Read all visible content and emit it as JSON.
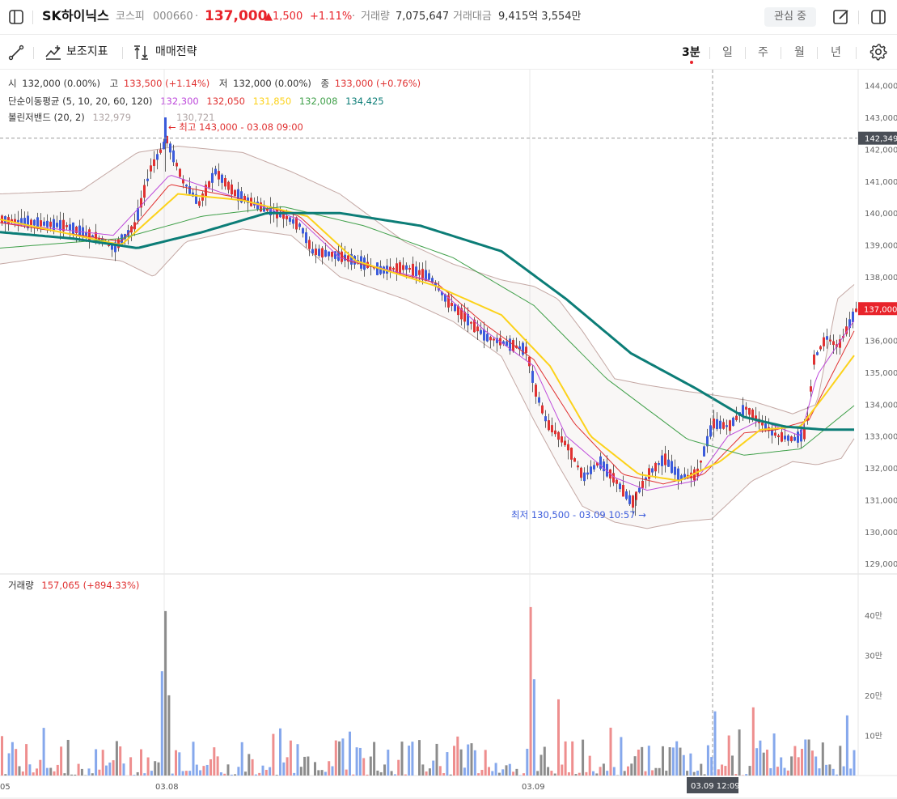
{
  "header": {
    "name": "SK하이닉스",
    "market": "코스피",
    "code": "000660",
    "dot": "·",
    "price": "137,000",
    "change": "▲1,500",
    "change_pct": "+1.11%",
    "volume_label": "거래량",
    "volume": "7,075,647",
    "amount_label": "거래대금",
    "amount": "9,415억 3,554만",
    "watch_label": "관심 중"
  },
  "toolbar": {
    "indicators_label": "보조지표",
    "strategy_label": "매매전략",
    "periods": [
      "3분",
      "일",
      "주",
      "월",
      "년"
    ]
  },
  "ohlc": {
    "open_label": "시",
    "open": "132,000 (0.00%)",
    "high_label": "고",
    "high": "133,500 (+1.14%)",
    "low_label": "저",
    "low": "132,000 (0.00%)",
    "close_label": "종",
    "close": "133,000 (+0.76%)"
  },
  "ma": {
    "label": "단순이동평균 (5, 10, 20, 60, 120)",
    "values": [
      "132,300",
      "132,050",
      "131,850",
      "132,008",
      "134,425"
    ],
    "colors": [
      "#be4bdb",
      "#e03131",
      "#fcc419",
      "#40a04a",
      "#0c7d77"
    ]
  },
  "bollinger": {
    "label": "볼린저밴드 (20, 2)",
    "upper": "132,979",
    "lower": "130,721"
  },
  "annotations": {
    "high": "← 최고 143,000 - 03.08 09:00",
    "low": "최저 130,500 - 03.09 10:57 →"
  },
  "crosshair_price": "142,349",
  "current_price_tag": "137,000",
  "crosshair_time": "03.09 12:09",
  "y_axis_labels": [
    "144,000",
    "143,000",
    "142,000",
    "141,000",
    "140,000",
    "139,000",
    "138,000",
    "137,000",
    "136,000",
    "135,000",
    "134,000",
    "133,000",
    "132,000",
    "131,000",
    "130,000",
    "129,000"
  ],
  "volume_panel": {
    "label": "거래량",
    "value": "157,065 (+894.33%)",
    "axis_labels": [
      "40만",
      "30만",
      "20만",
      "10만"
    ]
  },
  "x_axis_labels": [
    "05",
    "03.08",
    "03.09"
  ],
  "colors": {
    "up": "#e03131",
    "down": "#3b5bdb",
    "accent": "#e8242b"
  },
  "chart_data": {
    "type": "candlestick",
    "interval": "3분",
    "ylim": [
      128700,
      144500
    ],
    "volume_ylim": [
      0,
      440000
    ],
    "anchors": [
      [
        0,
        139800
      ],
      [
        40,
        139700
      ],
      [
        80,
        139600
      ],
      [
        120,
        139200
      ],
      [
        140,
        138900
      ],
      [
        165,
        139600
      ],
      [
        185,
        141400
      ],
      [
        205,
        142300
      ],
      [
        225,
        141000
      ],
      [
        245,
        140300
      ],
      [
        265,
        141300
      ],
      [
        290,
        140600
      ],
      [
        320,
        140200
      ],
      [
        350,
        139900
      ],
      [
        370,
        139600
      ],
      [
        385,
        138800
      ],
      [
        410,
        138700
      ],
      [
        440,
        138500
      ],
      [
        470,
        138200
      ],
      [
        500,
        138300
      ],
      [
        530,
        138000
      ],
      [
        550,
        137300
      ],
      [
        575,
        136700
      ],
      [
        600,
        136100
      ],
      [
        625,
        135900
      ],
      [
        650,
        135700
      ],
      [
        660,
        134500
      ],
      [
        675,
        133400
      ],
      [
        700,
        132700
      ],
      [
        720,
        131700
      ],
      [
        740,
        132200
      ],
      [
        760,
        131600
      ],
      [
        780,
        130900
      ],
      [
        800,
        131800
      ],
      [
        820,
        132300
      ],
      [
        840,
        131700
      ],
      [
        860,
        131800
      ],
      [
        880,
        133400
      ],
      [
        900,
        133300
      ],
      [
        920,
        133900
      ],
      [
        940,
        133400
      ],
      [
        960,
        133000
      ],
      [
        980,
        132900
      ],
      [
        995,
        133100
      ],
      [
        1005,
        135400
      ],
      [
        1020,
        136100
      ],
      [
        1035,
        135800
      ],
      [
        1058,
        137000
      ]
    ],
    "ma": [
      {
        "period": 5,
        "color": "#be4bdb",
        "anchors": [
          [
            0,
            139700
          ],
          [
            140,
            139300
          ],
          [
            210,
            141200
          ],
          [
            290,
            140500
          ],
          [
            370,
            139800
          ],
          [
            420,
            138600
          ],
          [
            530,
            137900
          ],
          [
            600,
            136300
          ],
          [
            660,
            135200
          ],
          [
            700,
            133000
          ],
          [
            760,
            131700
          ],
          [
            800,
            131300
          ],
          [
            860,
            131600
          ],
          [
            900,
            133000
          ],
          [
            940,
            133500
          ],
          [
            990,
            133000
          ],
          [
            1010,
            134900
          ],
          [
            1058,
            136700
          ]
        ]
      },
      {
        "period": 10,
        "color": "#e03131",
        "anchors": [
          [
            0,
            139700
          ],
          [
            150,
            139100
          ],
          [
            210,
            140900
          ],
          [
            290,
            140500
          ],
          [
            370,
            139900
          ],
          [
            430,
            138500
          ],
          [
            540,
            137800
          ],
          [
            600,
            136500
          ],
          [
            660,
            135400
          ],
          [
            710,
            133400
          ],
          [
            770,
            131800
          ],
          [
            820,
            131500
          ],
          [
            870,
            131800
          ],
          [
            920,
            133100
          ],
          [
            960,
            133200
          ],
          [
            1000,
            133500
          ],
          [
            1058,
            136400
          ]
        ]
      },
      {
        "period": 20,
        "color": "#fcd21a",
        "anchors": [
          [
            0,
            139800
          ],
          [
            150,
            139000
          ],
          [
            220,
            140600
          ],
          [
            300,
            140400
          ],
          [
            380,
            139900
          ],
          [
            440,
            138500
          ],
          [
            540,
            137700
          ],
          [
            620,
            136800
          ],
          [
            680,
            135200
          ],
          [
            730,
            133000
          ],
          [
            790,
            131800
          ],
          [
            840,
            131600
          ],
          [
            890,
            132200
          ],
          [
            940,
            133200
          ],
          [
            990,
            133300
          ],
          [
            1020,
            134300
          ],
          [
            1058,
            135600
          ]
        ]
      },
      {
        "period": 60,
        "color": "#40a04a",
        "anchors": [
          [
            0,
            138900
          ],
          [
            150,
            139200
          ],
          [
            250,
            139900
          ],
          [
            350,
            140200
          ],
          [
            450,
            139600
          ],
          [
            560,
            138600
          ],
          [
            660,
            137100
          ],
          [
            750,
            134800
          ],
          [
            850,
            132900
          ],
          [
            920,
            132400
          ],
          [
            990,
            132600
          ],
          [
            1058,
            134000
          ]
        ]
      },
      {
        "period": 120,
        "color": "#0c7d77",
        "anchors": [
          [
            0,
            139400
          ],
          [
            90,
            139200
          ],
          [
            170,
            138900
          ],
          [
            250,
            139400
          ],
          [
            330,
            140000
          ],
          [
            420,
            140000
          ],
          [
            520,
            139600
          ],
          [
            620,
            138800
          ],
          [
            700,
            137300
          ],
          [
            780,
            135600
          ],
          [
            860,
            134500
          ],
          [
            920,
            133600
          ],
          [
            970,
            133300
          ],
          [
            1020,
            133200
          ],
          [
            1058,
            133200
          ]
        ]
      }
    ],
    "bollinger": {
      "upper": [
        [
          0,
          140600
        ],
        [
          100,
          140700
        ],
        [
          170,
          141900
        ],
        [
          220,
          142100
        ],
        [
          300,
          141900
        ],
        [
          360,
          141300
        ],
        [
          420,
          140600
        ],
        [
          500,
          139100
        ],
        [
          560,
          138400
        ],
        [
          620,
          137900
        ],
        [
          660,
          137700
        ],
        [
          690,
          137300
        ],
        [
          720,
          136300
        ],
        [
          760,
          134800
        ],
        [
          800,
          134600
        ],
        [
          850,
          134400
        ],
        [
          880,
          134300
        ],
        [
          930,
          134100
        ],
        [
          980,
          133700
        ],
        [
          1010,
          134000
        ],
        [
          1035,
          137300
        ],
        [
          1058,
          137800
        ]
      ],
      "lower": [
        [
          0,
          138400
        ],
        [
          80,
          138700
        ],
        [
          150,
          138500
        ],
        [
          190,
          138000
        ],
        [
          230,
          139100
        ],
        [
          300,
          139500
        ],
        [
          360,
          139300
        ],
        [
          420,
          138000
        ],
        [
          500,
          137300
        ],
        [
          560,
          136600
        ],
        [
          620,
          135500
        ],
        [
          660,
          133500
        ],
        [
          690,
          132100
        ],
        [
          720,
          130800
        ],
        [
          760,
          130300
        ],
        [
          800,
          130100
        ],
        [
          840,
          130300
        ],
        [
          880,
          130400
        ],
        [
          930,
          131600
        ],
        [
          980,
          132200
        ],
        [
          1010,
          132100
        ],
        [
          1040,
          132300
        ],
        [
          1058,
          133000
        ]
      ]
    },
    "volume_spikes": [
      [
        203,
        410000
      ],
      [
        655,
        420000
      ],
      [
        200,
        260000
      ],
      [
        658,
        240000
      ],
      [
        207,
        200000
      ],
      [
        690,
        190000
      ],
      [
        881,
        160000
      ],
      [
        931,
        170000
      ],
      [
        1045,
        150000
      ]
    ]
  }
}
